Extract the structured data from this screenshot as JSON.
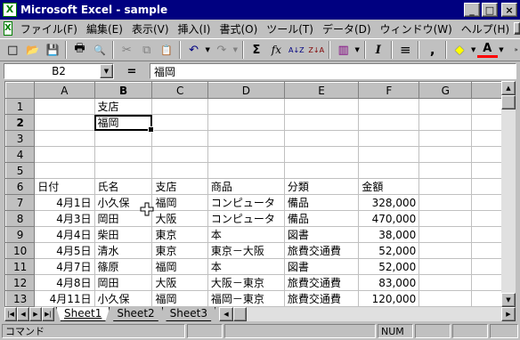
{
  "window": {
    "title": "Microsoft Excel - sample",
    "caption_buttons": [
      "_",
      "□",
      "×"
    ],
    "doc_caption_buttons": [
      "_",
      "▣",
      "×"
    ]
  },
  "menu": {
    "items": [
      "ファイル(F)",
      "編集(E)",
      "表示(V)",
      "挿入(I)",
      "書式(O)",
      "ツール(T)",
      "データ(D)",
      "ウィンドウ(W)",
      "ヘルプ(H)"
    ]
  },
  "toolbar": {
    "new": "□",
    "open": "📂",
    "save": "💾",
    "print": "🖶",
    "preview": "🔍",
    "cut": "✂",
    "copy": "⧉",
    "paste": "📋",
    "undo": "↶",
    "redo": "↷",
    "autosum": "Σ",
    "function": "fx",
    "sort_asc": "A↓Z",
    "sort_desc": "Z↓A",
    "chart": "▥",
    "italic": "I",
    "align": "≡",
    "comma": ",",
    "fill": "◆",
    "font_color": "A"
  },
  "formula_bar": {
    "name_box": "B2",
    "equals": "=",
    "content": "福岡"
  },
  "grid": {
    "columns": [
      "A",
      "B",
      "C",
      "D",
      "E",
      "F",
      "G"
    ],
    "active_column": "B",
    "active_row": "2",
    "rows": [
      {
        "n": "1",
        "cells": [
          "",
          "支店",
          "",
          "",
          "",
          "",
          ""
        ]
      },
      {
        "n": "2",
        "cells": [
          "",
          "福岡",
          "",
          "",
          "",
          "",
          ""
        ]
      },
      {
        "n": "3",
        "cells": [
          "",
          "",
          "",
          "",
          "",
          "",
          ""
        ]
      },
      {
        "n": "4",
        "cells": [
          "",
          "",
          "",
          "",
          "",
          "",
          ""
        ]
      },
      {
        "n": "5",
        "cells": [
          "",
          "",
          "",
          "",
          "",
          "",
          ""
        ]
      },
      {
        "n": "6",
        "cells": [
          "日付",
          "氏名",
          "支店",
          "商品",
          "分類",
          "金額",
          ""
        ]
      },
      {
        "n": "7",
        "cells": [
          "4月1日",
          "小久保",
          "福岡",
          "コンピュータ",
          "備品",
          "328,000",
          ""
        ]
      },
      {
        "n": "8",
        "cells": [
          "4月3日",
          "岡田",
          "大阪",
          "コンピュータ",
          "備品",
          "470,000",
          ""
        ]
      },
      {
        "n": "9",
        "cells": [
          "4月4日",
          "柴田",
          "東京",
          "本",
          "図書",
          "38,000",
          ""
        ]
      },
      {
        "n": "10",
        "cells": [
          "4月5日",
          "清水",
          "東京",
          "東京－大阪",
          "旅費交通費",
          "52,000",
          ""
        ]
      },
      {
        "n": "11",
        "cells": [
          "4月7日",
          "篠原",
          "福岡",
          "本",
          "図書",
          "52,000",
          ""
        ]
      },
      {
        "n": "12",
        "cells": [
          "4月8日",
          "岡田",
          "大阪",
          "大阪－東京",
          "旅費交通費",
          "83,000",
          ""
        ]
      },
      {
        "n": "13",
        "cells": [
          "4月11日",
          "小久保",
          "福岡",
          "福岡－東京",
          "旅費交通費",
          "120,000",
          ""
        ]
      }
    ]
  },
  "sheets": {
    "nav": [
      "|◀",
      "◀",
      "▶",
      "▶|"
    ],
    "tabs": [
      "Sheet1",
      "Sheet2",
      "Sheet3"
    ],
    "active": "Sheet1"
  },
  "status": {
    "mode": "コマンド",
    "num": "NUM"
  }
}
